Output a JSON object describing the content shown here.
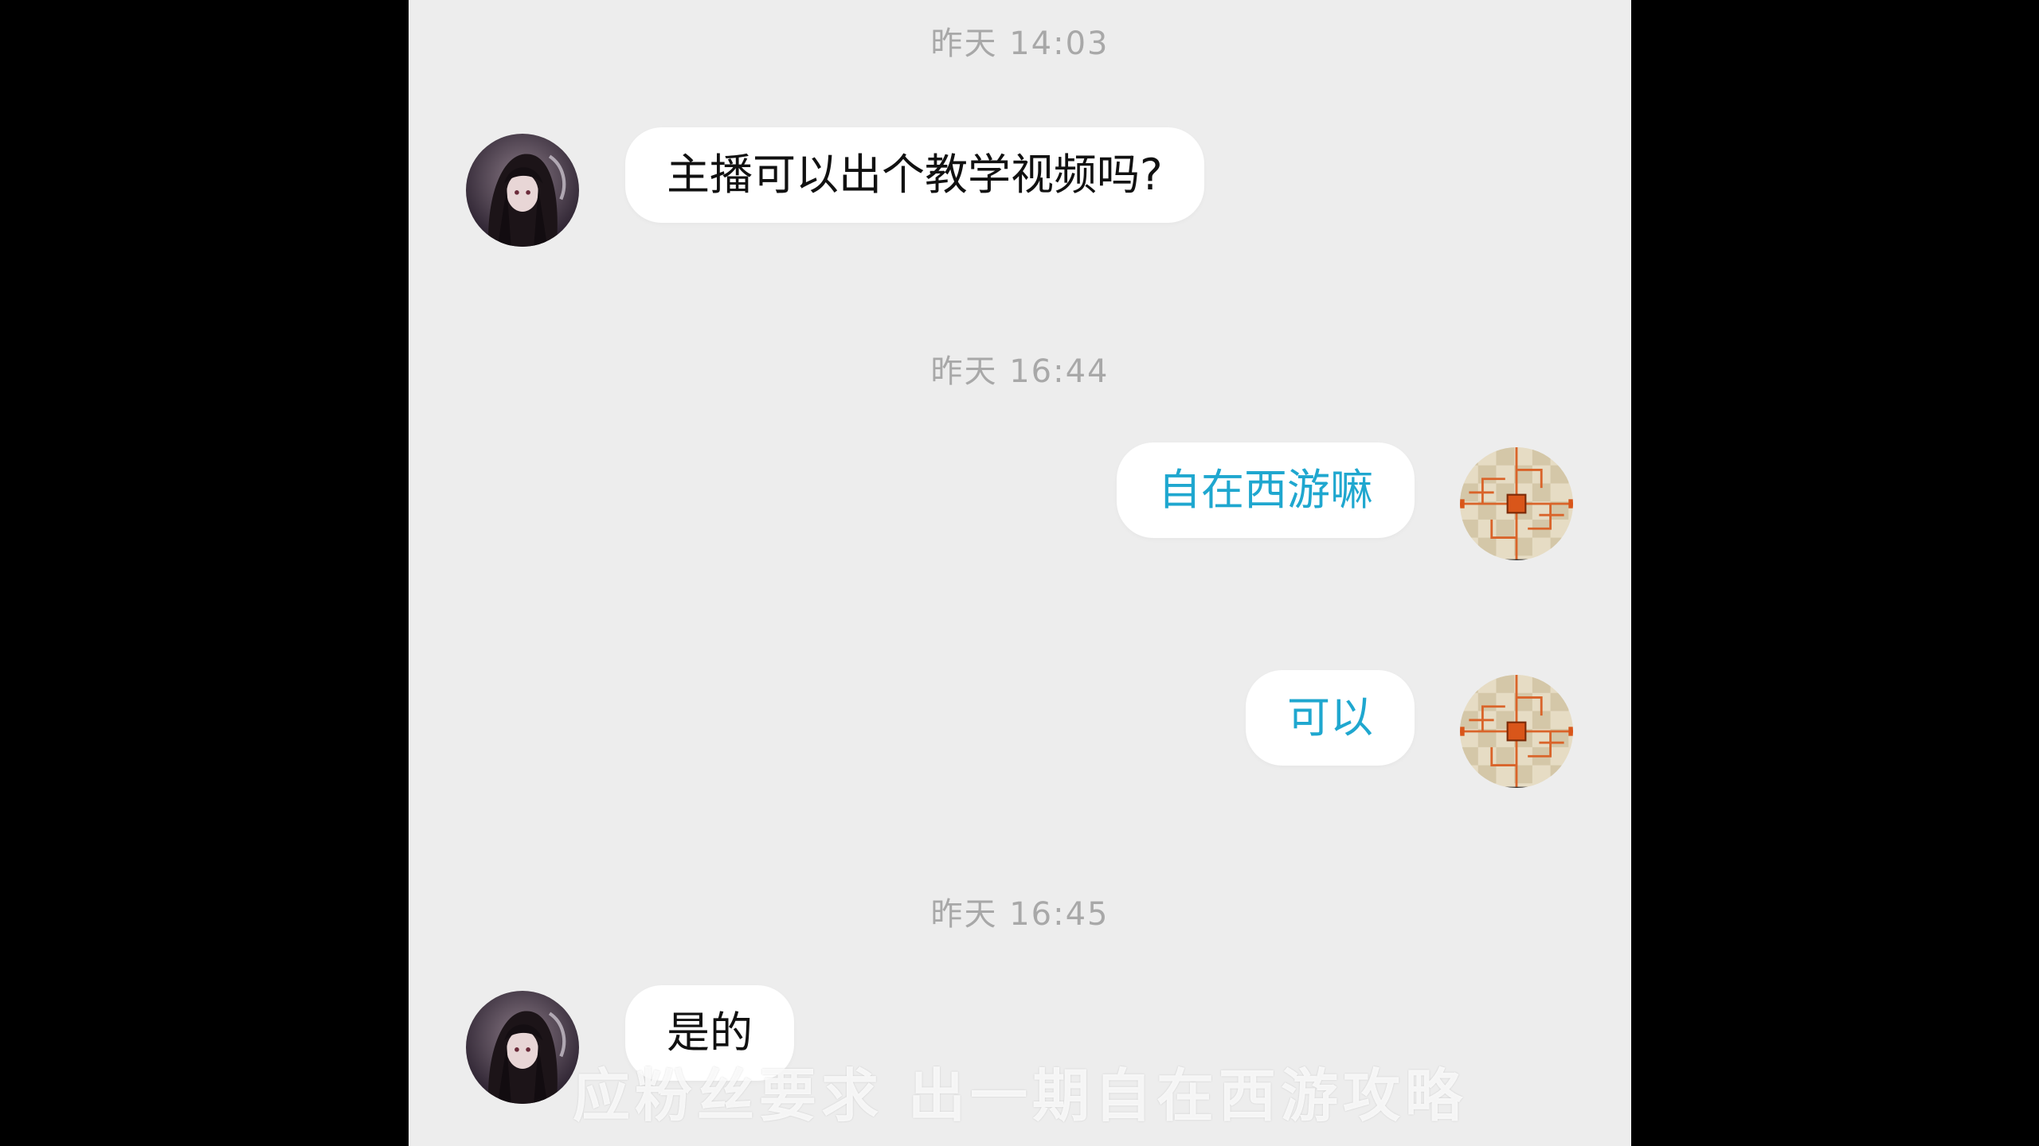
{
  "chat": {
    "timestamps": [
      "昨天 14:03",
      "昨天 16:44",
      "昨天 16:45"
    ],
    "messages": [
      {
        "side": "incoming",
        "text": "主播可以出个教学视频吗?"
      },
      {
        "side": "outgoing",
        "text": "自在西游嘛"
      },
      {
        "side": "outgoing",
        "text": "可以"
      },
      {
        "side": "incoming",
        "text": "是的"
      }
    ]
  },
  "overlay": {
    "subtitle": "应粉丝要求 出一期自在西游攻略"
  },
  "colors": {
    "background": "#ededed",
    "bubble": "#ffffff",
    "incoming_text": "#111111",
    "outgoing_text": "#1fa7cf",
    "timestamp": "#a8a8a8",
    "letterbox": "#000000"
  },
  "icons": {
    "incoming_avatar": "dark-haired-anime-girl-avatar",
    "outgoing_avatar": "orange-circuit-board-avatar"
  }
}
